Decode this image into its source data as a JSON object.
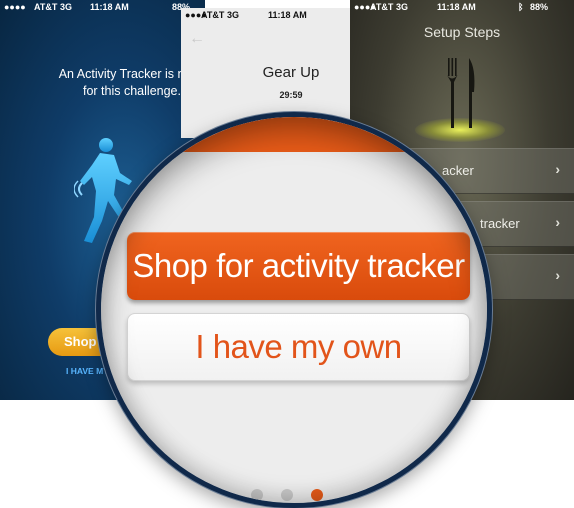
{
  "status_bar": {
    "carrier": "AT&T",
    "network": "3G",
    "time": "11:18 AM",
    "battery": "88%"
  },
  "left_screen": {
    "message": "An Activity Tracker is need\nfor this challenge.",
    "shop_button": "Shop",
    "own_link": "I HAVE MY"
  },
  "middle_screen": {
    "title": "Gear Up",
    "timer": "29:59",
    "back_icon": "left-arrow-icon",
    "next_icon": "right-arrow-icon"
  },
  "right_screen": {
    "header": "Setup Steps",
    "rows": [
      {
        "label": "acker"
      },
      {
        "label": "tracker"
      },
      {
        "label": ""
      }
    ],
    "chevron": "›"
  },
  "magnifier": {
    "primary_button": "Shop for activity tracker",
    "secondary_button": "I have my own"
  },
  "colors": {
    "accent_orange": "#e85b18",
    "left_bg": "#0f3c68",
    "link_blue": "#59b6ff"
  }
}
